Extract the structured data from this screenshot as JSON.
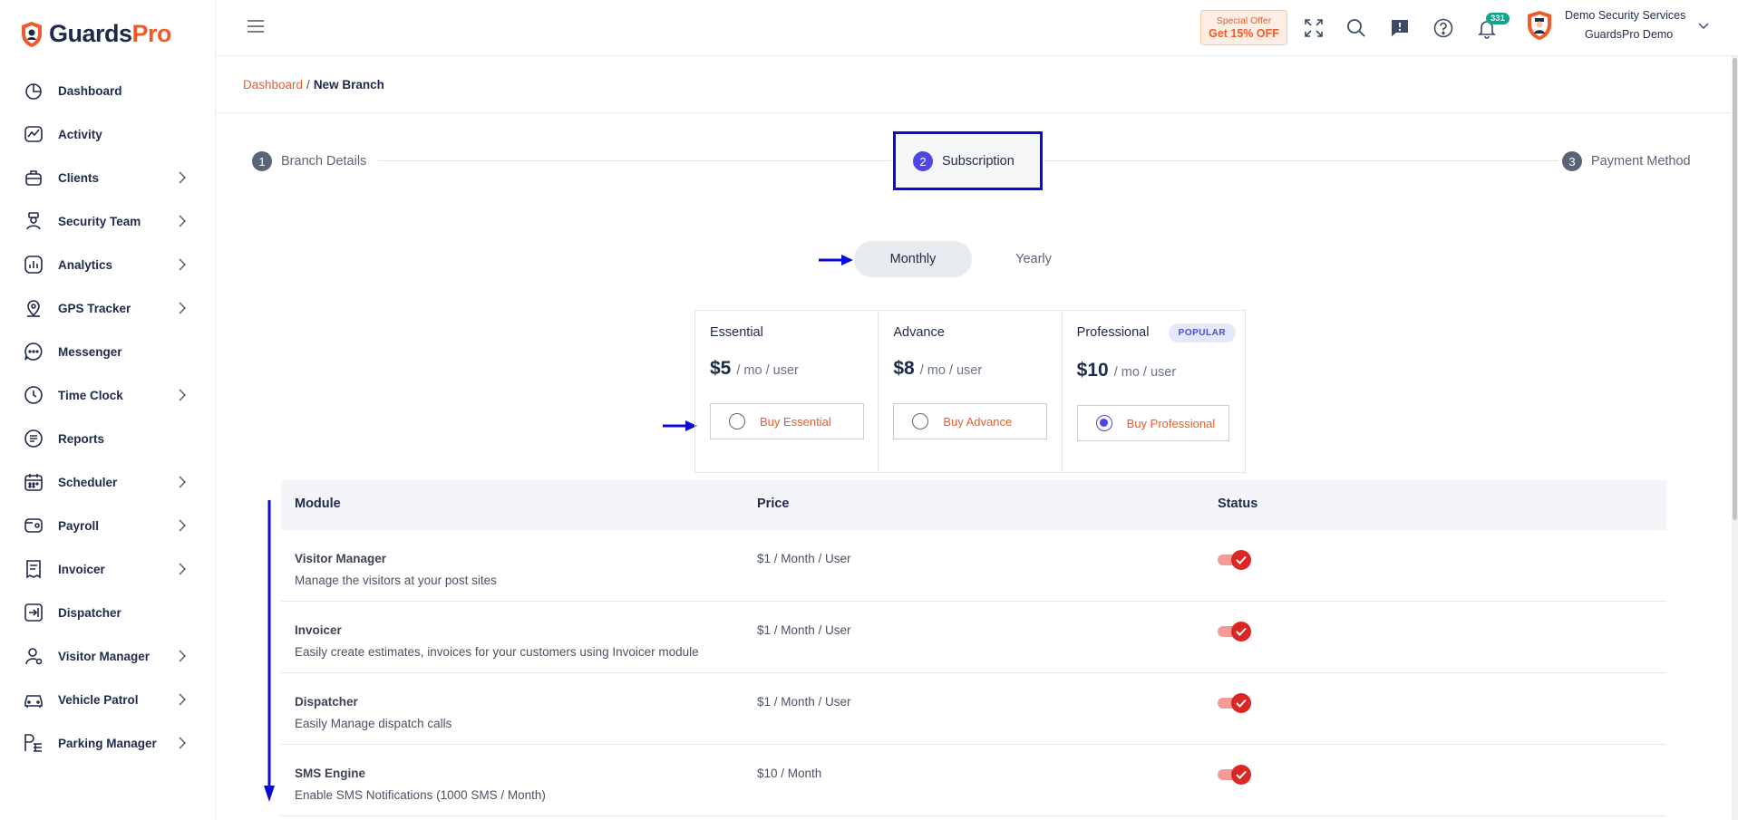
{
  "brand": {
    "part1": "Guards",
    "part2": "Pro"
  },
  "sidebar": {
    "items": [
      {
        "label": "Dashboard",
        "icon": "dashboard-icon",
        "chevron": false
      },
      {
        "label": "Activity",
        "icon": "activity-icon",
        "chevron": false
      },
      {
        "label": "Clients",
        "icon": "clients-icon",
        "chevron": true
      },
      {
        "label": "Security Team",
        "icon": "security-team-icon",
        "chevron": true
      },
      {
        "label": "Analytics",
        "icon": "analytics-icon",
        "chevron": true
      },
      {
        "label": "GPS Tracker",
        "icon": "gps-icon",
        "chevron": true
      },
      {
        "label": "Messenger",
        "icon": "messenger-icon",
        "chevron": false
      },
      {
        "label": "Time Clock",
        "icon": "clock-icon",
        "chevron": true
      },
      {
        "label": "Reports",
        "icon": "reports-icon",
        "chevron": false
      },
      {
        "label": "Scheduler",
        "icon": "calendar-icon",
        "chevron": true
      },
      {
        "label": "Payroll",
        "icon": "payroll-icon",
        "chevron": true
      },
      {
        "label": "Invoicer",
        "icon": "invoice-icon",
        "chevron": true
      },
      {
        "label": "Dispatcher",
        "icon": "dispatcher-icon",
        "chevron": false
      },
      {
        "label": "Visitor Manager",
        "icon": "visitor-icon",
        "chevron": true
      },
      {
        "label": "Vehicle Patrol",
        "icon": "car-icon",
        "chevron": true
      },
      {
        "label": "Parking Manager",
        "icon": "parking-icon",
        "chevron": true
      }
    ]
  },
  "topbar": {
    "offer_line1": "Special Offer",
    "offer_line2": "Get 15% OFF",
    "notification_count": "331",
    "user_name": "Demo Security Services",
    "user_org": "GuardsPro Demo"
  },
  "breadcrumb": {
    "root": "Dashboard",
    "separator": "/",
    "current": "New Branch"
  },
  "stepper": {
    "steps": [
      {
        "num": "1",
        "label": "Branch Details"
      },
      {
        "num": "2",
        "label": "Subscription"
      },
      {
        "num": "3",
        "label": "Payment Method"
      }
    ],
    "active": 2
  },
  "billing": {
    "monthly": "Monthly",
    "yearly": "Yearly",
    "selected": "Monthly"
  },
  "plans": [
    {
      "name": "Essential",
      "price": "$5",
      "unit": "/ mo / user",
      "button": "Buy Essential",
      "selected": false,
      "badge": ""
    },
    {
      "name": "Advance",
      "price": "$8",
      "unit": "/ mo / user",
      "button": "Buy Advance",
      "selected": false,
      "badge": ""
    },
    {
      "name": "Professional",
      "price": "$10",
      "unit": "/ mo / user",
      "button": "Buy Professional",
      "selected": true,
      "badge": "POPULAR"
    }
  ],
  "table": {
    "headers": {
      "module": "Module",
      "price": "Price",
      "status": "Status"
    },
    "rows": [
      {
        "name": "Visitor Manager",
        "desc": "Manage the visitors at your post sites",
        "price": "$1 / Month / User",
        "enabled": true
      },
      {
        "name": "Invoicer",
        "desc": "Easily create estimates, invoices for your customers using Invoicer module",
        "price": "$1 / Month / User",
        "enabled": true
      },
      {
        "name": "Dispatcher",
        "desc": "Easily Manage dispatch calls",
        "price": "$1 / Month / User",
        "enabled": true
      },
      {
        "name": "SMS Engine",
        "desc": "Enable SMS Notifications (1000 SMS / Month)",
        "price": "$10 / Month",
        "enabled": true
      }
    ]
  },
  "colors": {
    "brand_orange": "#f05a28",
    "navy": "#1e2a4a",
    "accent": "#4f46e5",
    "annotation_blue": "#0b0bd6",
    "toggle_red": "#dc2626"
  }
}
